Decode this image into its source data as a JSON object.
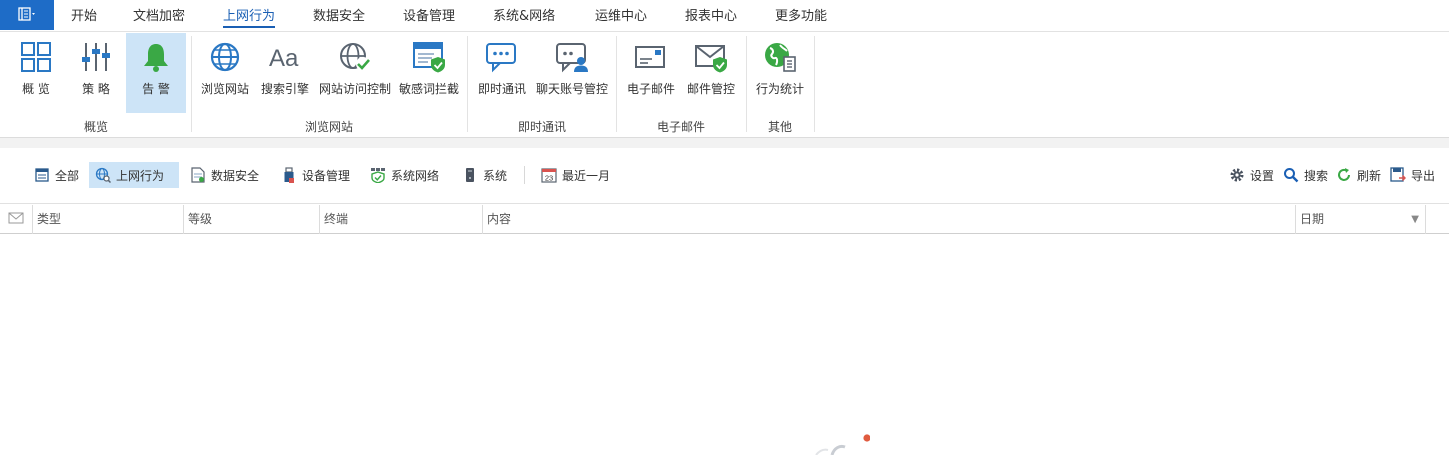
{
  "menu": {
    "app_icon": "app-menu-icon",
    "tabs": [
      {
        "label": "开始"
      },
      {
        "label": "文档加密"
      },
      {
        "label": "上网行为",
        "active": true
      },
      {
        "label": "数据安全"
      },
      {
        "label": "设备管理"
      },
      {
        "label": "系统&网络"
      },
      {
        "label": "运维中心"
      },
      {
        "label": "报表中心"
      },
      {
        "label": "更多功能"
      }
    ]
  },
  "ribbon": {
    "buttons": [
      {
        "label": "概 览",
        "icon": "grid-icon"
      },
      {
        "label": "策 略",
        "icon": "sliders-icon"
      },
      {
        "label": "告 警",
        "icon": "bell-icon",
        "active": true
      },
      {
        "label": "浏览网站",
        "icon": "globe-icon"
      },
      {
        "label": "搜索引擎",
        "icon": "font-icon"
      },
      {
        "label": "网站访问控制",
        "icon": "globe-check-icon"
      },
      {
        "label": "敏感词拦截",
        "icon": "browser-shield-icon"
      },
      {
        "label": "即时通讯",
        "icon": "chat-icon"
      },
      {
        "label": "聊天账号管控",
        "icon": "chat-user-icon"
      },
      {
        "label": "电子邮件",
        "icon": "envelope-icon"
      },
      {
        "label": "邮件管控",
        "icon": "mail-shield-icon"
      },
      {
        "label": "行为统计",
        "icon": "globe-stats-icon"
      }
    ],
    "groups": [
      {
        "label": "概览"
      },
      {
        "label": "浏览网站"
      },
      {
        "label": "即时通讯"
      },
      {
        "label": "电子邮件"
      },
      {
        "label": "其他"
      }
    ]
  },
  "filters": {
    "items": [
      {
        "label": "全部",
        "icon": "list-icon"
      },
      {
        "label": "上网行为",
        "icon": "web-search-icon",
        "active": true
      },
      {
        "label": "数据安全",
        "icon": "document-icon"
      },
      {
        "label": "设备管理",
        "icon": "usb-icon"
      },
      {
        "label": "系统网络",
        "icon": "network-shield-icon"
      },
      {
        "label": "系统",
        "icon": "server-icon"
      },
      {
        "label": "最近一月",
        "icon": "calendar-icon",
        "day": "23"
      }
    ],
    "actions": [
      {
        "label": "设置",
        "icon": "gear-icon"
      },
      {
        "label": "搜索",
        "icon": "search-icon"
      },
      {
        "label": "刷新",
        "icon": "refresh-icon"
      },
      {
        "label": "导出",
        "icon": "export-icon"
      }
    ]
  },
  "table": {
    "columns": [
      {
        "label": "",
        "icon": "envelope-icon"
      },
      {
        "label": "类型"
      },
      {
        "label": "等级"
      },
      {
        "label": "终端"
      },
      {
        "label": "内容"
      },
      {
        "label": "日期"
      }
    ]
  },
  "colors": {
    "accent": "#1a5fb4",
    "app_button": "#1e6cc7",
    "active_bg": "#cde4f7",
    "bell": "#3aa845",
    "icon_blue": "#2a78c4",
    "icon_gray": "#5a6470",
    "check_green": "#3aa845"
  }
}
